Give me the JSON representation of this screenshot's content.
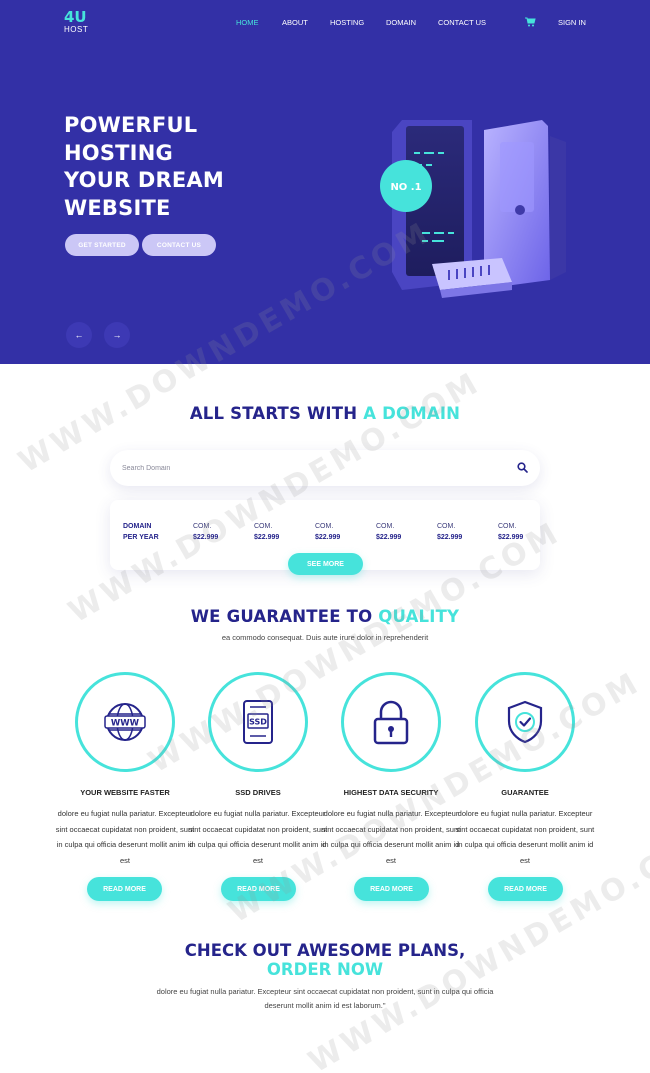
{
  "brand": {
    "logo_main": "4U",
    "logo_sub": "HOST"
  },
  "nav": {
    "items": [
      {
        "label": "HOME",
        "active": true
      },
      {
        "label": "ABOUT",
        "active": false
      },
      {
        "label": "HOSTING",
        "active": false
      },
      {
        "label": "DOMAIN",
        "active": false
      },
      {
        "label": "CONTACT US",
        "active": false
      }
    ],
    "signin": "SIGN IN",
    "cart_icon": "cart-icon"
  },
  "hero": {
    "title_lines": [
      "POWERFUL",
      "HOSTING",
      "YOUR DREAM",
      "WEBSITE"
    ],
    "get_started": "GET STARTED",
    "contact_us": "CONTACT US",
    "badge": "NO .1",
    "prev_arrow": "←",
    "next_arrow": "→"
  },
  "domain": {
    "heading_main": "ALL STARTS WITH",
    "heading_accent": "A DOMAIN",
    "search_placeholder": "Search Domain",
    "price_head_line1": "DOMAIN",
    "price_head_line2": "PER YEAR",
    "prices": [
      {
        "tld": "COM.",
        "price": "$22.999"
      },
      {
        "tld": "COM.",
        "price": "$22.999"
      },
      {
        "tld": "COM.",
        "price": "$22.999"
      },
      {
        "tld": "COM.",
        "price": "$22.999"
      },
      {
        "tld": "COM.",
        "price": "$22.999"
      },
      {
        "tld": "COM.",
        "price": "$22.999"
      }
    ],
    "see_more": "SEE MORE"
  },
  "guarantee": {
    "heading_main": "WE GUARANTEE TO",
    "heading_accent": "QUALITY",
    "subtitle": "ea commodo consequat. Duis aute irure dolor in reprehenderit",
    "features": [
      {
        "title": "YOUR WEBSITE FASTER",
        "icon": "www-globe-icon",
        "desc": "dolore eu fugiat nulla pariatur. Excepteur sint occaecat cupidatat non proident, sunt in culpa qui officia deserunt mollit anim id est",
        "button": "READ MORE"
      },
      {
        "title": "SSD DRIVES",
        "icon": "ssd-icon",
        "desc": "dolore eu fugiat nulla pariatur. Excepteur sint occaecat cupidatat non proident, sunt in culpa qui officia deserunt mollit anim id est",
        "button": "READ MORE"
      },
      {
        "title": "HIGHEST DATA SECURITY",
        "icon": "padlock-icon",
        "desc": "dolore eu fugiat nulla pariatur. Excepteur sint occaecat cupidatat non proident, sunt in culpa qui officia deserunt mollit anim id est",
        "button": "READ MORE"
      },
      {
        "title": "GUARANTEE",
        "icon": "shield-check-icon",
        "desc": "dolore eu fugiat nulla pariatur. Excepteur sint occaecat cupidatat non proident, sunt in culpa qui officia deserunt mollit anim id est",
        "button": "READ MORE"
      }
    ]
  },
  "plans": {
    "heading_main": "CHECK OUT AWESOME PLANS,",
    "heading_accent": "ORDER NOW",
    "desc": "dolore eu fugiat nulla pariatur. Excepteur sint occaecat cupidatat non proident, sunt in culpa qui officia deserunt mollit anim id est laborum.\""
  },
  "watermark": "WWW.DOWNDEMO.COM",
  "colors": {
    "primary": "#3330a6",
    "accent": "#46e3db",
    "heading": "#25248b"
  }
}
